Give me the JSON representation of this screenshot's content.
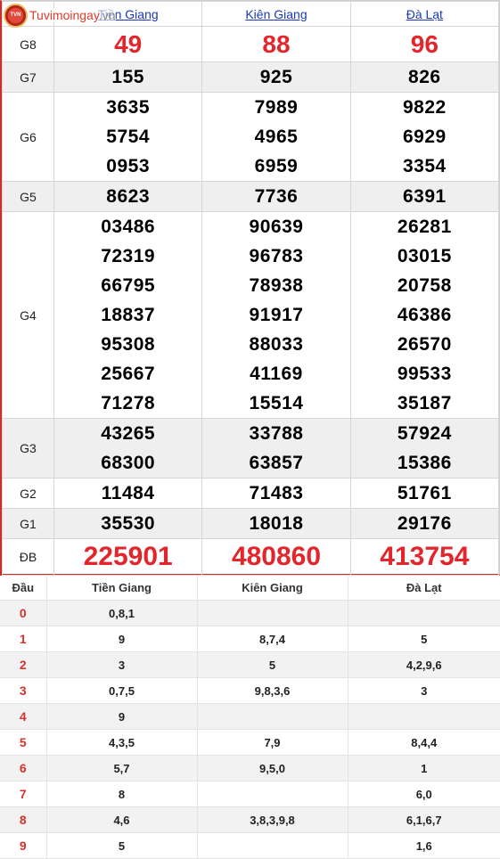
{
  "logo": {
    "badge": "TVN",
    "name": "Tuvimoingay",
    "domain": ".vn"
  },
  "provinces": [
    "Tiền Giang",
    "Kiên Giang",
    "Đà Lạt"
  ],
  "prizes": [
    {
      "label": "G8",
      "style": "big",
      "values": [
        [
          "49"
        ],
        [
          "88"
        ],
        [
          "96"
        ]
      ]
    },
    {
      "label": "G7",
      "style": "num",
      "values": [
        [
          "155"
        ],
        [
          "925"
        ],
        [
          "826"
        ]
      ]
    },
    {
      "label": "G6",
      "style": "num",
      "values": [
        [
          "3635",
          "5754",
          "0953"
        ],
        [
          "7989",
          "4965",
          "6959"
        ],
        [
          "9822",
          "6929",
          "3354"
        ]
      ]
    },
    {
      "label": "G5",
      "style": "num",
      "values": [
        [
          "8623"
        ],
        [
          "7736"
        ],
        [
          "6391"
        ]
      ]
    },
    {
      "label": "G4",
      "style": "num",
      "values": [
        [
          "03486",
          "72319",
          "66795",
          "18837",
          "95308",
          "25667",
          "71278"
        ],
        [
          "90639",
          "96783",
          "78938",
          "91917",
          "88033",
          "41169",
          "15514"
        ],
        [
          "26281",
          "03015",
          "20758",
          "46386",
          "26570",
          "99533",
          "35187"
        ]
      ]
    },
    {
      "label": "G3",
      "style": "num",
      "values": [
        [
          "43265",
          "68300"
        ],
        [
          "33788",
          "63857"
        ],
        [
          "57924",
          "15386"
        ]
      ]
    },
    {
      "label": "G2",
      "style": "num",
      "values": [
        [
          "11484"
        ],
        [
          "71483"
        ],
        [
          "51761"
        ]
      ]
    },
    {
      "label": "G1",
      "style": "num",
      "values": [
        [
          "35530"
        ],
        [
          "18018"
        ],
        [
          "29176"
        ]
      ]
    },
    {
      "label": "ĐB",
      "style": "db",
      "values": [
        [
          "225901"
        ],
        [
          "480860"
        ],
        [
          "413754"
        ]
      ]
    }
  ],
  "dau_table": {
    "headers": [
      "Đầu",
      "Tiền Giang",
      "Kiên Giang",
      "Đà Lạt"
    ],
    "rows": [
      {
        "d": "0",
        "v": [
          "0,8,1",
          "",
          ""
        ]
      },
      {
        "d": "1",
        "v": [
          "9",
          "8,7,4",
          "5"
        ]
      },
      {
        "d": "2",
        "v": [
          "3",
          "5",
          "4,2,9,6"
        ]
      },
      {
        "d": "3",
        "v": [
          "0,7,5",
          "9,8,3,6",
          "3"
        ]
      },
      {
        "d": "4",
        "v": [
          "9",
          "",
          ""
        ]
      },
      {
        "d": "5",
        "v": [
          "4,3,5",
          "7,9",
          "8,4,4"
        ]
      },
      {
        "d": "6",
        "v": [
          "5,7",
          "9,5,0",
          "1"
        ]
      },
      {
        "d": "7",
        "v": [
          "8",
          "",
          "6,0"
        ]
      },
      {
        "d": "8",
        "v": [
          "4,6",
          "3,8,3,9,8",
          "6,1,6,7"
        ]
      },
      {
        "d": "9",
        "v": [
          "5",
          "",
          "1,6"
        ]
      }
    ]
  },
  "colors": {
    "accent": "#e3262c",
    "link": "#1a37b8",
    "alt_row": "#efefef"
  }
}
